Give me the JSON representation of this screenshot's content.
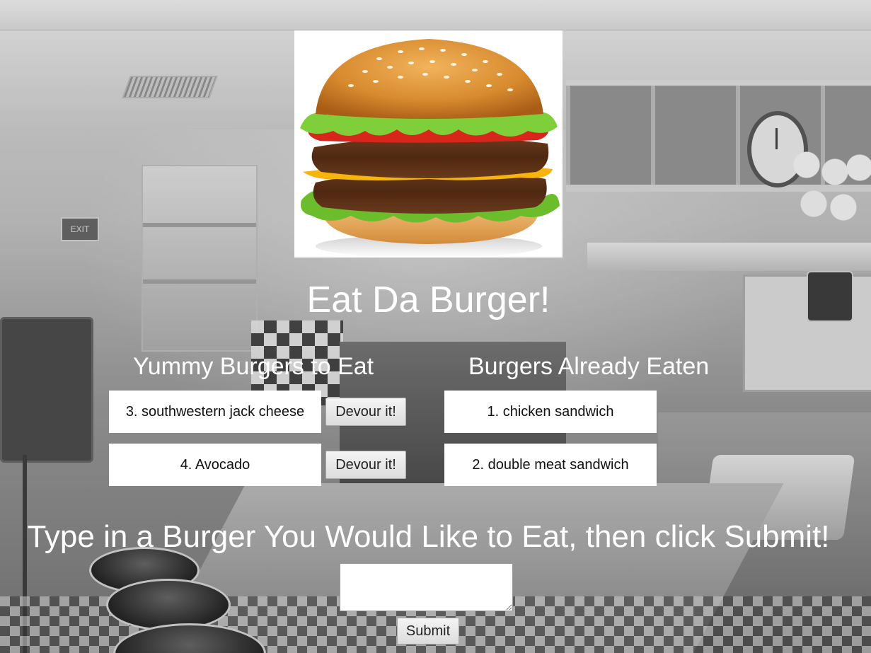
{
  "page": {
    "title": "Eat Da Burger!",
    "prompt": "Type in a Burger You Would Like to Eat, then click Submit!",
    "submit_label": "Submit",
    "input_value": ""
  },
  "to_eat": {
    "heading": "Yummy Burgers to Eat",
    "devour_label": "Devour it!",
    "items": [
      {
        "label": "3. southwestern jack cheese"
      },
      {
        "label": "4. Avocado"
      }
    ]
  },
  "eaten": {
    "heading": "Burgers Already Eaten",
    "items": [
      {
        "label": "1. chicken sandwich"
      },
      {
        "label": "2. double meat sandwich"
      }
    ]
  },
  "colors": {
    "text_light": "#ffffff",
    "box_background": "#ffffff",
    "button_background": "#e8e8e8"
  }
}
